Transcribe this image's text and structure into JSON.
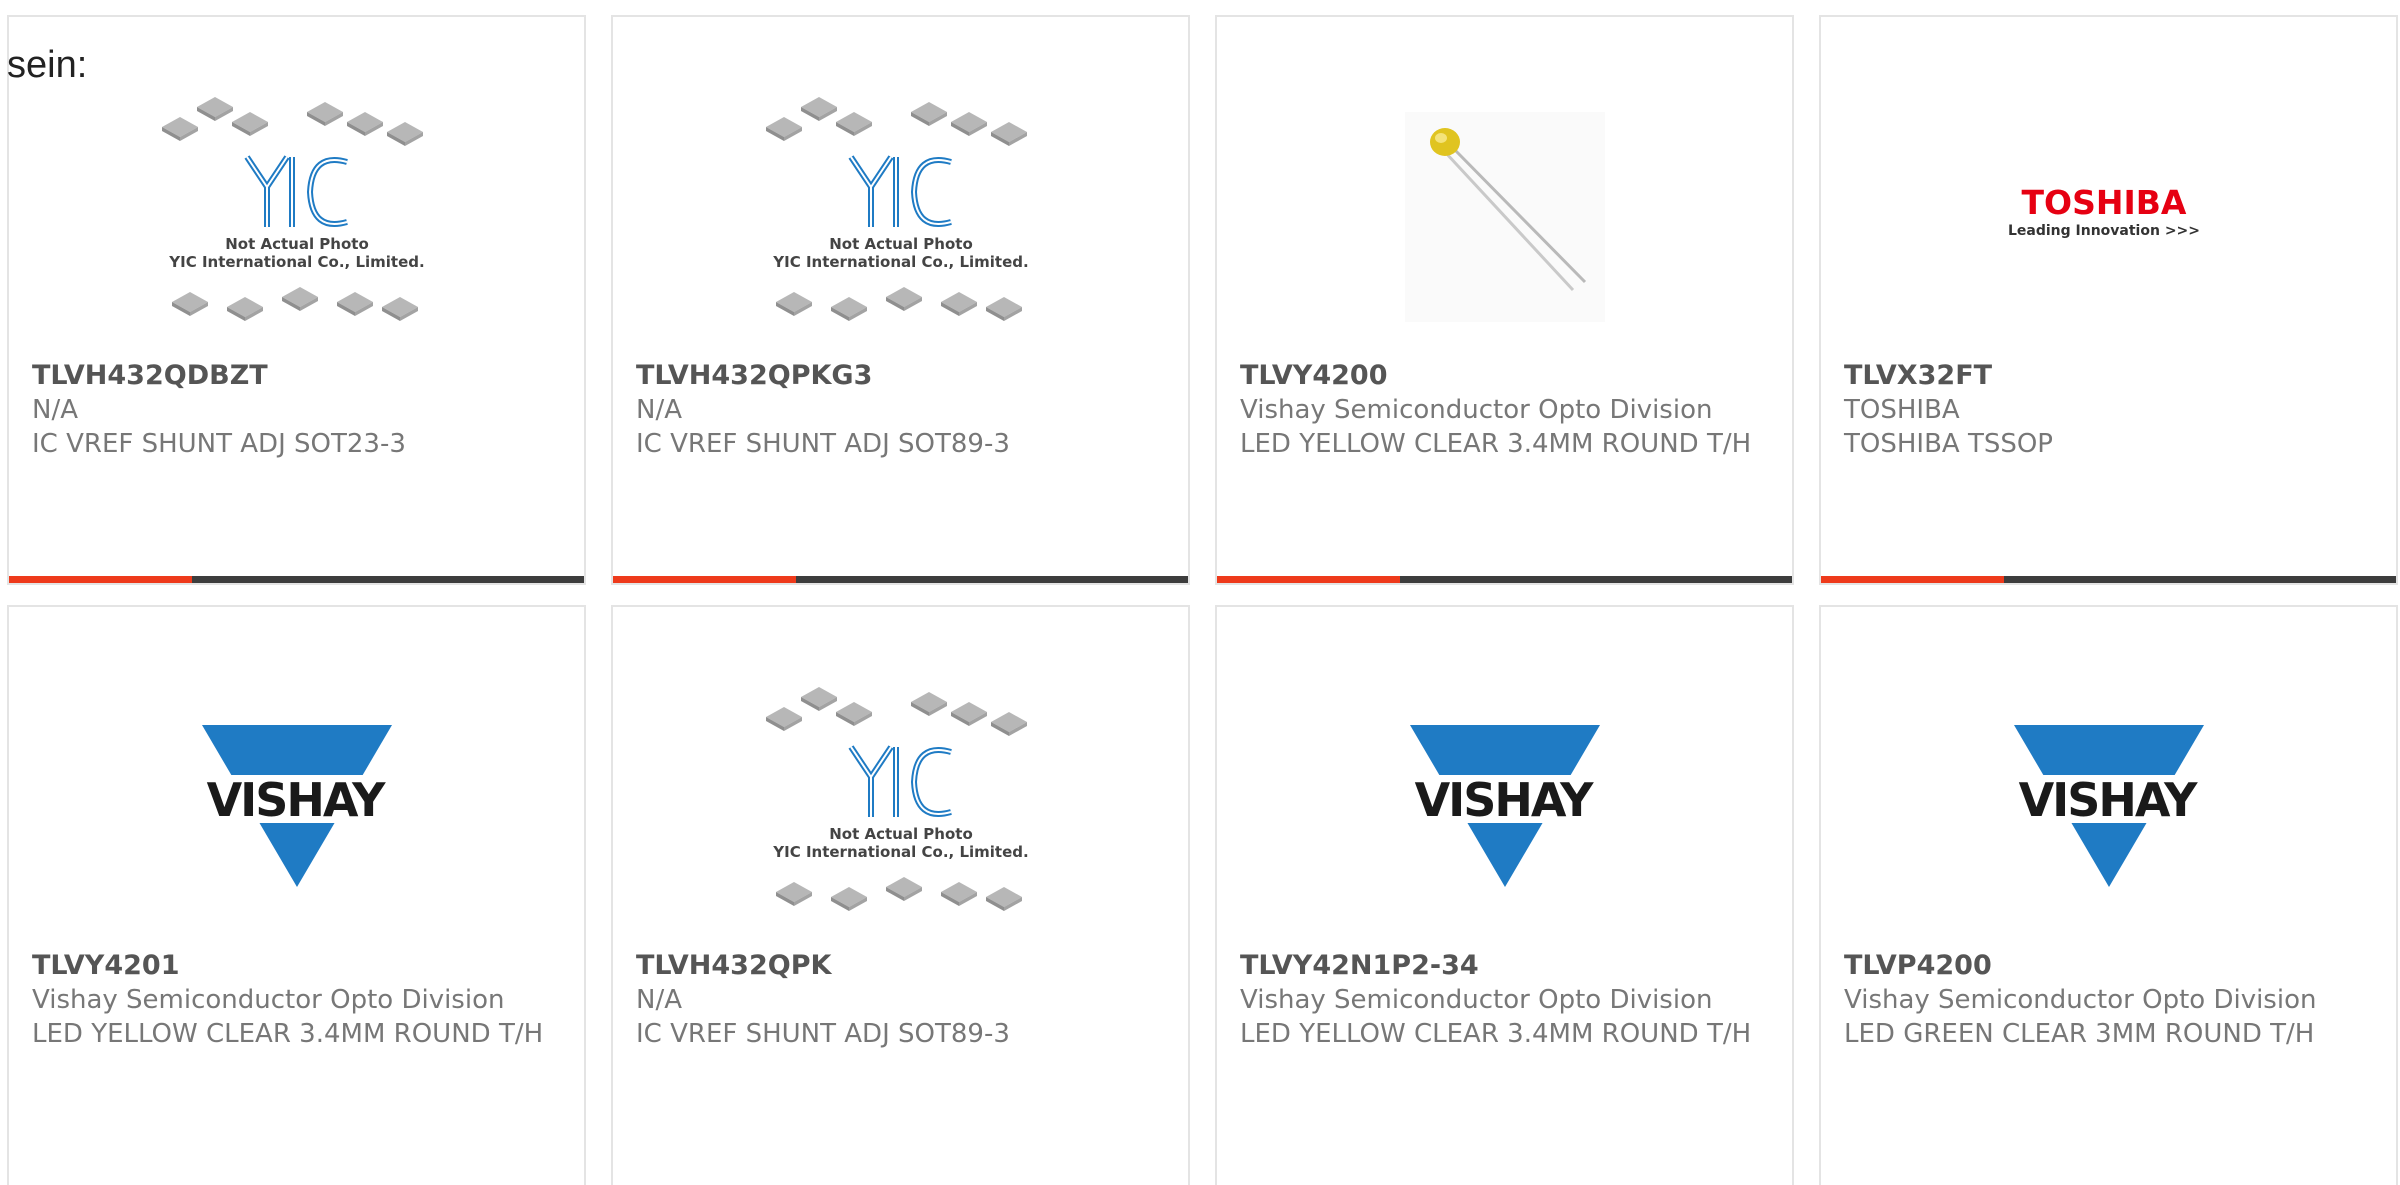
{
  "lead_text": "sein:",
  "placeholder_image": {
    "line1": "Not Actual Photo",
    "line2": "YIC International Co., Limited."
  },
  "logos": {
    "vishay": "VISHAY",
    "toshiba": "TOSHIBA",
    "toshiba_tagline": "Leading Innovation >>>"
  },
  "colors": {
    "accent": "#ee3a1b",
    "bar": "#3d3d3d",
    "vishay_blue": "#1f7bc4",
    "toshiba_red": "#e60012"
  },
  "products": [
    {
      "part": "TLVH432QDBZT",
      "maker": "N/A",
      "desc": "IC VREF SHUNT ADJ SOT23-3",
      "image": "yic-placeholder"
    },
    {
      "part": "TLVH432QPKG3",
      "maker": "N/A",
      "desc": "IC VREF SHUNT ADJ SOT89-3",
      "image": "yic-placeholder"
    },
    {
      "part": "TLVY4200",
      "maker": "Vishay Semiconductor Opto Division",
      "desc": "LED YELLOW CLEAR 3.4MM ROUND T/H",
      "image": "led-yellow-photo"
    },
    {
      "part": "TLVX32FT",
      "maker": "TOSHIBA",
      "desc": "TOSHIBA TSSOP",
      "image": "toshiba-logo"
    },
    {
      "part": "TLVY4201",
      "maker": "Vishay Semiconductor Opto Division",
      "desc": "LED YELLOW CLEAR 3.4MM ROUND T/H",
      "image": "vishay-logo"
    },
    {
      "part": "TLVH432QPK",
      "maker": "N/A",
      "desc": "IC VREF SHUNT ADJ SOT89-3",
      "image": "yic-placeholder"
    },
    {
      "part": "TLVY42N1P2-34",
      "maker": "Vishay Semiconductor Opto Division",
      "desc": "LED YELLOW CLEAR 3.4MM ROUND T/H",
      "image": "vishay-logo"
    },
    {
      "part": "TLVP4200",
      "maker": "Vishay Semiconductor Opto Division",
      "desc": "LED GREEN CLEAR 3MM ROUND T/H",
      "image": "vishay-logo"
    }
  ]
}
